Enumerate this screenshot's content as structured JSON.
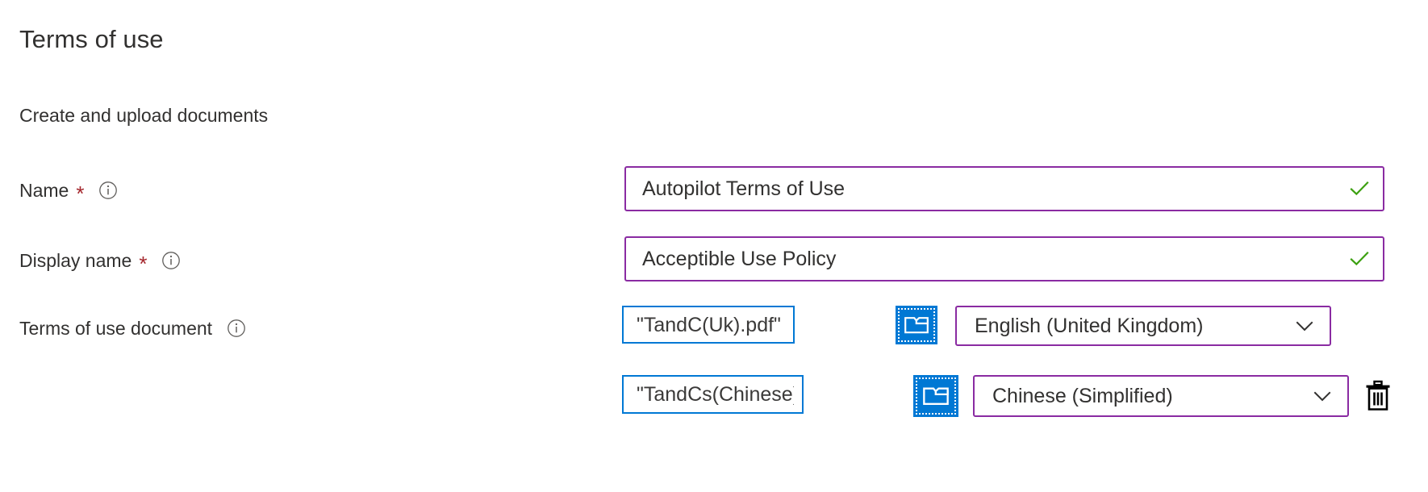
{
  "page": {
    "title": "Terms of use",
    "subtitle": "Create and upload documents"
  },
  "colors": {
    "accent_purple": "#8A2BA2",
    "accent_blue": "#0078D4",
    "required_red": "#a4262c",
    "valid_green": "#3CA010",
    "text": "#323130"
  },
  "fields": {
    "name": {
      "label": "Name",
      "required_marker": "*",
      "info_icon": "info-icon",
      "value": "Autopilot Terms of Use",
      "validation_icon": "checkmark-icon"
    },
    "display_name": {
      "label": "Display name",
      "required_marker": "*",
      "info_icon": "info-icon",
      "value": "Acceptible Use Policy",
      "validation_icon": "checkmark-icon"
    },
    "document": {
      "label": "Terms of use document",
      "info_icon": "info-icon",
      "rows": [
        {
          "file_value": "\"TandC(Uk).pdf\"",
          "browse_icon": "folder-icon",
          "language": "English (United Kingdom)",
          "dropdown_icon": "chevron-down-icon",
          "has_delete": false
        },
        {
          "file_value": "\"TandCs(Chinese).p...",
          "browse_icon": "folder-icon",
          "language": "Chinese (Simplified)",
          "dropdown_icon": "chevron-down-icon",
          "has_delete": true,
          "delete_icon": "trash-icon"
        }
      ]
    }
  }
}
